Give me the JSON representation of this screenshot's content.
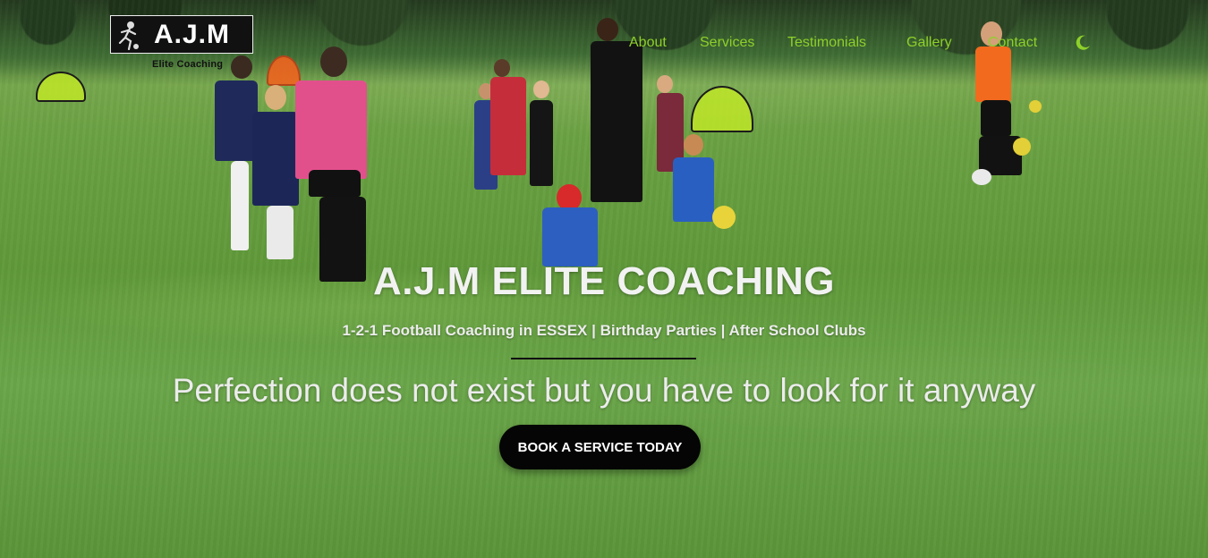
{
  "header": {
    "logo_text": "A.J.M",
    "logo_subtext": "Elite Coaching",
    "nav": [
      {
        "label": "About"
      },
      {
        "label": "Services"
      },
      {
        "label": "Testimonials"
      },
      {
        "label": "Gallery"
      },
      {
        "label": "Contact"
      }
    ],
    "theme_toggle_icon": "moon-icon",
    "accent_color": "#8ed02a"
  },
  "hero": {
    "title": "A.J.M ELITE COACHING",
    "subtitle": "1-2-1 Football Coaching in ESSEX | Birthday Parties | After School Clubs",
    "quote": "Perfection does not exist but you have to look for it anyway",
    "cta_label": "BOOK A SERVICE TODAY"
  }
}
